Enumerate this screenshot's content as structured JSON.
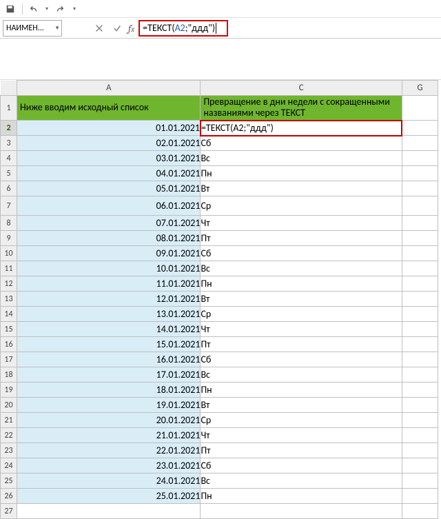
{
  "qat": {
    "save": "save-icon",
    "undo": "undo-icon",
    "redo": "redo-icon"
  },
  "nameBox": "НАИМЕН...",
  "formula": {
    "prefix": "=ТЕКСТ(",
    "ref": "A2",
    "suffix": ";\"ддд\")"
  },
  "columns": {
    "A": "A",
    "C": "C",
    "G": "G"
  },
  "headers": {
    "A": "Ниже вводим исходный список",
    "C": "Превращение в дни недели с сокращенными названиями через ТЕКСТ"
  },
  "editCellFormula": "=ТЕКСТ(A2;\"ддд\")",
  "rows": [
    {
      "n": "2",
      "date": "01.01.2021",
      "day": ""
    },
    {
      "n": "3",
      "date": "02.01.2021",
      "day": "Сб"
    },
    {
      "n": "4",
      "date": "03.01.2021",
      "day": "Вс"
    },
    {
      "n": "5",
      "date": "04.01.2021",
      "day": "Пн"
    },
    {
      "n": "6",
      "date": "05.01.2021",
      "day": "Вт"
    },
    {
      "n": "7",
      "date": "06.01.2021",
      "day": "Ср"
    },
    {
      "n": "8",
      "date": "07.01.2021",
      "day": "Чт"
    },
    {
      "n": "9",
      "date": "08.01.2021",
      "day": "Пт"
    },
    {
      "n": "10",
      "date": "09.01.2021",
      "day": "Сб"
    },
    {
      "n": "11",
      "date": "10.01.2021",
      "day": "Вс"
    },
    {
      "n": "12",
      "date": "11.01.2021",
      "day": "Пн"
    },
    {
      "n": "13",
      "date": "12.01.2021",
      "day": "Вт"
    },
    {
      "n": "14",
      "date": "13.01.2021",
      "day": "Ср"
    },
    {
      "n": "15",
      "date": "14.01.2021",
      "day": "Чт"
    },
    {
      "n": "16",
      "date": "15.01.2021",
      "day": "Пт"
    },
    {
      "n": "17",
      "date": "16.01.2021",
      "day": "Сб"
    },
    {
      "n": "18",
      "date": "17.01.2021",
      "day": "Вс"
    },
    {
      "n": "19",
      "date": "18.01.2021",
      "day": "Пн"
    },
    {
      "n": "20",
      "date": "19.01.2021",
      "day": "Вт"
    },
    {
      "n": "21",
      "date": "20.01.2021",
      "day": "Ср"
    },
    {
      "n": "22",
      "date": "21.01.2021",
      "day": "Чт"
    },
    {
      "n": "23",
      "date": "22.01.2021",
      "day": "Пт"
    },
    {
      "n": "24",
      "date": "23.01.2021",
      "day": "Сб"
    },
    {
      "n": "25",
      "date": "24.01.2021",
      "day": "Вс"
    },
    {
      "n": "26",
      "date": "25.01.2021",
      "day": "Пн"
    },
    {
      "n": "27",
      "date": "",
      "day": ""
    }
  ]
}
